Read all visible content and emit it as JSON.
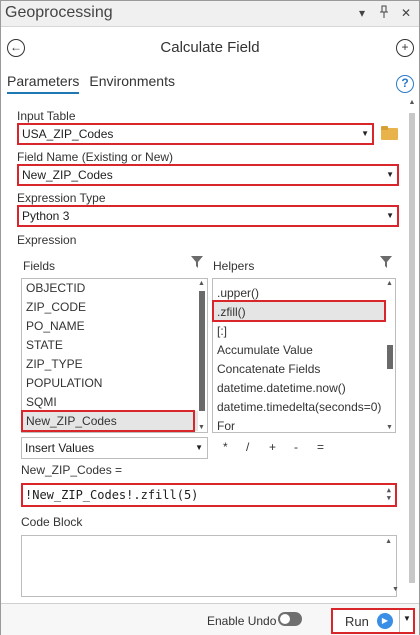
{
  "titlebar": {
    "title": "Geoprocessing"
  },
  "header": {
    "title": "Calculate Field"
  },
  "tabs": [
    {
      "label": "Parameters",
      "active": true
    },
    {
      "label": "Environments",
      "active": false
    }
  ],
  "input_table": {
    "label": "Input Table",
    "value": "USA_ZIP_Codes"
  },
  "field_name": {
    "label": "Field Name (Existing or New)",
    "value": "New_ZIP_Codes"
  },
  "expression_type": {
    "label": "Expression Type",
    "value": "Python 3"
  },
  "expression": {
    "label": "Expression",
    "fields_label": "Fields",
    "helpers_label": "Helpers",
    "fields": [
      "OBJECTID",
      "ZIP_CODE",
      "PO_NAME",
      "STATE",
      "ZIP_TYPE",
      "POPULATION",
      "SQMI",
      "New_ZIP_Codes"
    ],
    "selected_field": "New_ZIP_Codes",
    "helpers": [
      ".upper()",
      ".zfill()",
      "[:]",
      "Accumulate Value",
      "Concatenate Fields",
      "datetime.datetime.now()",
      "datetime.timedelta(seconds=0)",
      "For"
    ],
    "selected_helper": ".zfill()",
    "insert_values": "Insert Values",
    "operators": [
      "*",
      "/",
      "+",
      "-",
      "="
    ],
    "target_label": "New_ZIP_Codes =",
    "value": "!New_ZIP_Codes!.zfill(5)"
  },
  "code_block": {
    "label": "Code Block",
    "value": ""
  },
  "footer": {
    "enable_undo": "Enable Undo",
    "run": "Run"
  },
  "colors": {
    "highlight": "#d9262b",
    "accent": "#1f77b4",
    "run_icon": "#3a8ee6"
  }
}
